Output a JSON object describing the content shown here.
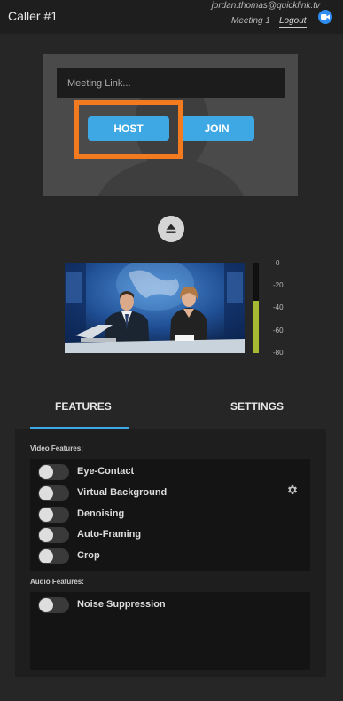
{
  "header": {
    "title": "Caller #1",
    "user_email": "jordan.thomas@quicklink.tv",
    "meeting_name": "Meeting 1",
    "logout_label": "Logout"
  },
  "meeting": {
    "link_placeholder": "Meeting Link...",
    "host_label": "HOST",
    "join_label": "JOIN"
  },
  "audio_meter": {
    "level_fraction": 0.58,
    "fill_color": "#a8b832",
    "scale_labels": [
      "0",
      "-20",
      "-40",
      "-60",
      "-80"
    ]
  },
  "tabs": {
    "features_label": "FEATURES",
    "settings_label": "SETTINGS",
    "active": "features"
  },
  "video_features": {
    "title": "Video Features:",
    "items": [
      {
        "label": "Eye-Contact",
        "enabled": false
      },
      {
        "label": "Virtual Background",
        "enabled": false
      },
      {
        "label": "Denoising",
        "enabled": false
      },
      {
        "label": "Auto-Framing",
        "enabled": false
      },
      {
        "label": "Crop",
        "enabled": false
      }
    ]
  },
  "audio_features": {
    "title": "Audio Features:",
    "items": [
      {
        "label": "Noise Suppression",
        "enabled": false
      }
    ]
  },
  "icons": {
    "camera": "video-camera-icon",
    "eject": "eject-icon",
    "settings": "gear-icon"
  },
  "colors": {
    "accent": "#3ea8e5",
    "highlight": "#f47a20",
    "camera_button": "#2f8cf0"
  }
}
